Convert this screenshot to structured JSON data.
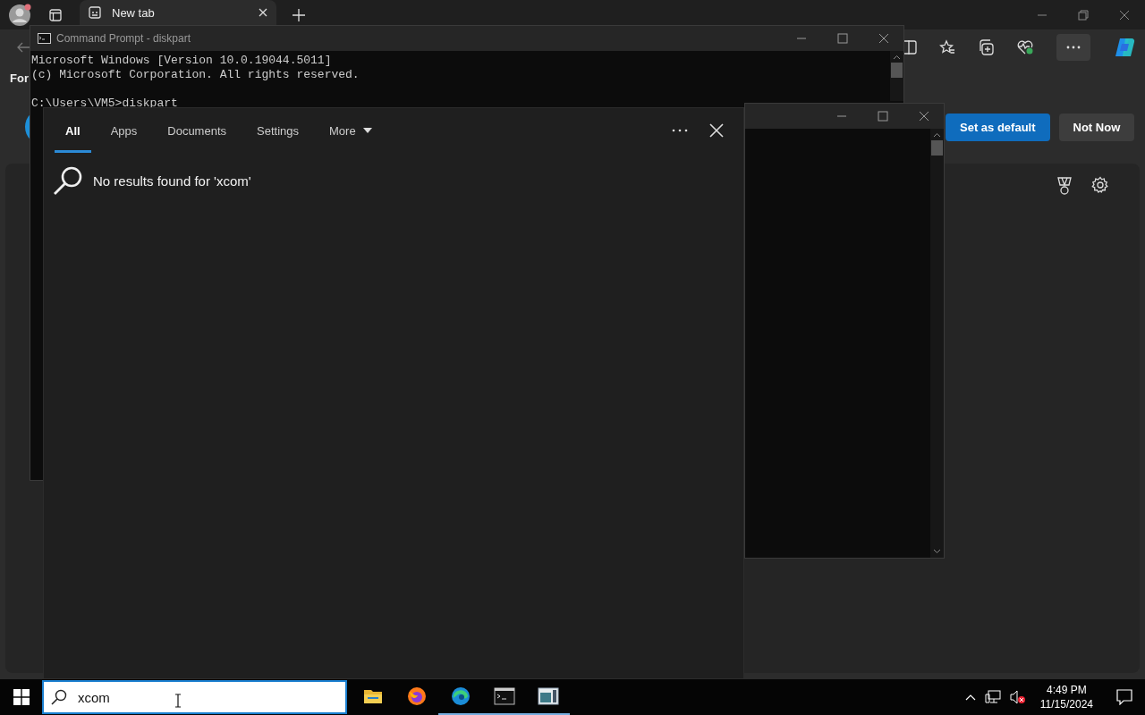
{
  "browser": {
    "tab": {
      "title": "New tab"
    },
    "side_text": "For",
    "prompt_buttons": [
      {
        "label": "Set as default",
        "kind": "primary"
      },
      {
        "label": "Not Now",
        "kind": "secondary"
      }
    ]
  },
  "cmd_window": {
    "title": "Command Prompt - diskpart",
    "lines": [
      "Microsoft Windows [Version 10.0.19044.5011]",
      "(c) Microsoft Corporation. All rights reserved."
    ],
    "prompt": "C:\\Users\\VM5>diskpart"
  },
  "search_panel": {
    "tabs": [
      {
        "label": "All",
        "selected": true
      },
      {
        "label": "Apps",
        "selected": false
      },
      {
        "label": "Documents",
        "selected": false
      },
      {
        "label": "Settings",
        "selected": false
      },
      {
        "label": "More",
        "selected": false
      }
    ],
    "message": "No results found for 'xcom'"
  },
  "taskbar": {
    "search": {
      "value": "xcom"
    },
    "apps": [
      {
        "kind": "explorer",
        "running": false
      },
      {
        "kind": "firefox",
        "running": false
      },
      {
        "kind": "edge",
        "running": true
      },
      {
        "kind": "terminal",
        "running": true
      },
      {
        "kind": "window",
        "running": true
      }
    ],
    "clock": {
      "time": "4:49 PM",
      "date": "11/15/2024"
    }
  }
}
